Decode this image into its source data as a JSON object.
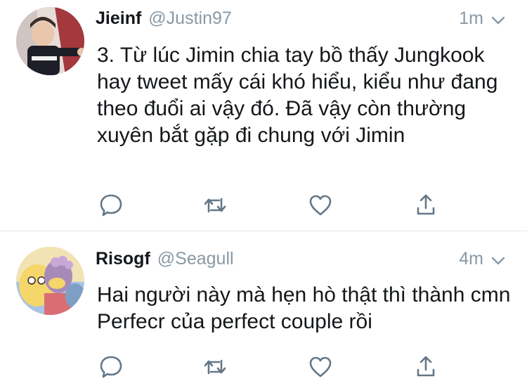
{
  "tweets": [
    {
      "name": "Jieinf",
      "handle": "@Justin97",
      "time": "1m",
      "text": "3. Từ lúc Jimin chia tay bồ thấy Jungkook hay tweet mấy cái khó hiểu, kiểu như đang theo đuổi ai vậy đó. Đã vậy còn thường xuyên bắt gặp đi chung với Jimin"
    },
    {
      "name": "Risogf",
      "handle": "@Seagull",
      "time": "4m",
      "text": "Hai người này mà hẹn hò thật thì thành cmn Perfecr của perfect couple rồi"
    }
  ],
  "icons": {
    "reply": "reply-icon",
    "retweet": "retweet-icon",
    "like": "heart-icon",
    "share": "share-icon",
    "caret": "chevron-down-icon"
  },
  "colors": {
    "icon": "#657786",
    "secondary_text": "#8899a6",
    "divider": "#e1e8ed"
  }
}
